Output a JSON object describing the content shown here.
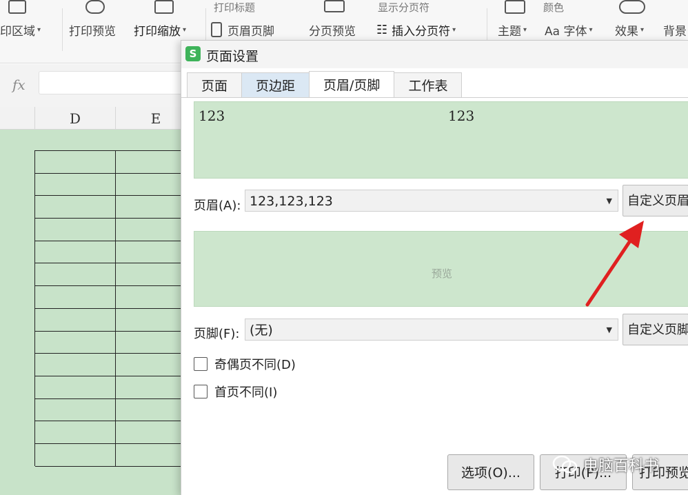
{
  "ribbon": {
    "top_labels": [
      "打印标题",
      "显示分页符",
      "颜色"
    ],
    "items": [
      {
        "label": "印区域",
        "dropdown": true
      },
      {
        "label": "打印预览",
        "dropdown": false
      },
      {
        "label": "打印缩放",
        "dropdown": true
      },
      {
        "label": "页眉页脚",
        "dropdown": false
      },
      {
        "label": "分页预览",
        "dropdown": false
      },
      {
        "label": "插入分页符",
        "dropdown": true
      },
      {
        "label": "主题",
        "dropdown": true
      },
      {
        "label": "Aa 字体",
        "dropdown": true
      },
      {
        "label": "效果",
        "dropdown": true
      },
      {
        "label": "背景",
        "dropdown": false
      }
    ]
  },
  "formula_bar": {
    "fx": "fx",
    "value": ""
  },
  "sheet": {
    "columns": [
      "D",
      "E"
    ],
    "grid_rows": 14
  },
  "dialog": {
    "title": "页面设置",
    "logo": "S",
    "tabs": [
      "页面",
      "页边距",
      "页眉/页脚",
      "工作表"
    ],
    "active_tab": "页眉/页脚",
    "header_preview": {
      "left": "123",
      "center": "123"
    },
    "header_label": "页眉(A):",
    "header_value": "123,123,123",
    "custom_header_button": "自定义页眉",
    "footer_preview_text": "预览",
    "footer_label": "页脚(F):",
    "footer_value": "(无)",
    "custom_footer_button": "自定义页脚",
    "checkbox_odd_even": "奇偶页不同(D)",
    "checkbox_first_page": "首页不同(I)",
    "options_button": "选项(O)...",
    "print_button": "打印(P)...",
    "print_preview_button": "打印预览"
  },
  "annotation": {
    "arrow_color": "#e02020"
  },
  "watermark": {
    "text": "电脑百科书"
  }
}
